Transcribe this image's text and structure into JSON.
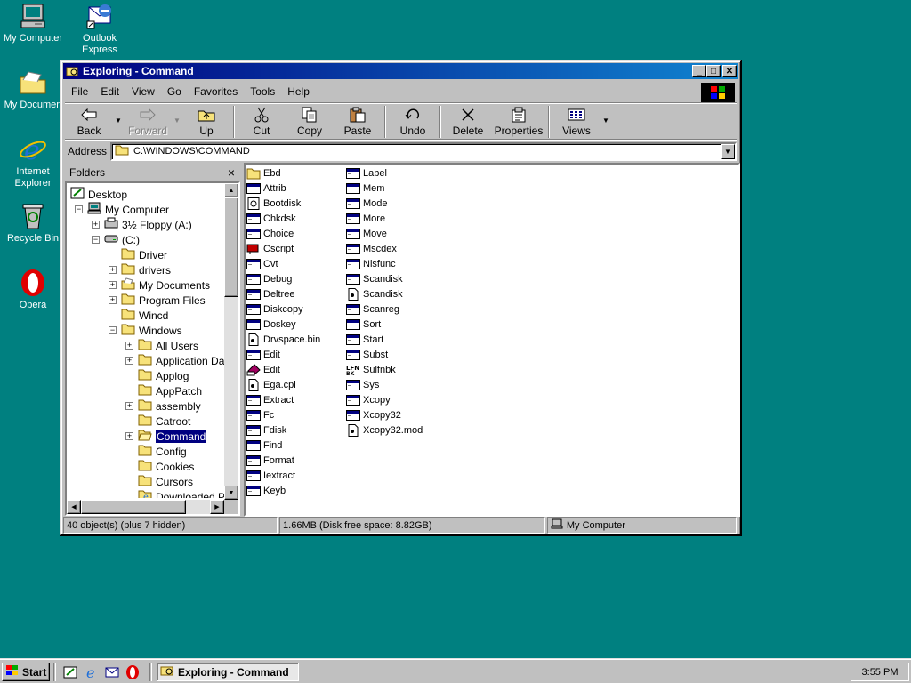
{
  "desktop": {
    "icons": [
      {
        "label1": "My Computer",
        "label2": ""
      },
      {
        "label1": "Outlook",
        "label2": "Express"
      },
      {
        "label1": "My Documen",
        "label2": ""
      },
      {
        "label1": "Internet",
        "label2": "Explorer"
      },
      {
        "label1": "Recycle Bin",
        "label2": ""
      },
      {
        "label1": "Opera",
        "label2": ""
      }
    ]
  },
  "window": {
    "title": "Exploring - Command",
    "menu": [
      "File",
      "Edit",
      "View",
      "Go",
      "Favorites",
      "Tools",
      "Help"
    ],
    "toolbar": {
      "back": "Back",
      "forward": "Forward",
      "up": "Up",
      "cut": "Cut",
      "copy": "Copy",
      "paste": "Paste",
      "undo": "Undo",
      "delete": "Delete",
      "properties": "Properties",
      "views": "Views"
    },
    "address": {
      "label": "Address",
      "value": "C:\\WINDOWS\\COMMAND"
    },
    "folders": {
      "title": "Folders",
      "close": "×"
    },
    "tree": [
      {
        "label": "Desktop"
      },
      {
        "label": "My Computer"
      },
      {
        "label": "3½ Floppy (A:)"
      },
      {
        "label": "(C:)"
      },
      {
        "label": "Driver"
      },
      {
        "label": "drivers"
      },
      {
        "label": "My Documents"
      },
      {
        "label": "Program Files"
      },
      {
        "label": "Wincd"
      },
      {
        "label": "Windows"
      },
      {
        "label": "All Users"
      },
      {
        "label": "Application Data"
      },
      {
        "label": "Applog"
      },
      {
        "label": "AppPatch"
      },
      {
        "label": "assembly"
      },
      {
        "label": "Catroot"
      },
      {
        "label": "Command"
      },
      {
        "label": "Config"
      },
      {
        "label": "Cookies"
      },
      {
        "label": "Cursors"
      },
      {
        "label": "Downloaded Prog"
      }
    ],
    "files_col1": [
      "Ebd",
      "Attrib",
      "Bootdisk",
      "Chkdsk",
      "Choice",
      "Cscript",
      "Cvt",
      "Debug",
      "Deltree",
      "Diskcopy",
      "Doskey",
      "Drvspace.bin",
      "Edit",
      "Edit",
      "Ega.cpi",
      "Extract",
      "Fc",
      "Fdisk",
      "Find",
      "Format",
      "Iextract",
      "Keyb"
    ],
    "files_col2": [
      "Label",
      "Mem",
      "Mode",
      "More",
      "Move",
      "Mscdex",
      "Nlsfunc",
      "Scandisk",
      "Scandisk",
      "Scanreg",
      "Sort",
      "Start",
      "Subst",
      "Sulfnbk",
      "Sys",
      "Xcopy",
      "Xcopy32",
      "Xcopy32.mod"
    ],
    "status": {
      "objects": "40 object(s) (plus 7 hidden)",
      "size": "1.66MB (Disk free space: 8.82GB)",
      "location": "My Computer"
    }
  },
  "taskbar": {
    "start": "Start",
    "task": "Exploring - Command",
    "clock": "3:55 PM"
  }
}
